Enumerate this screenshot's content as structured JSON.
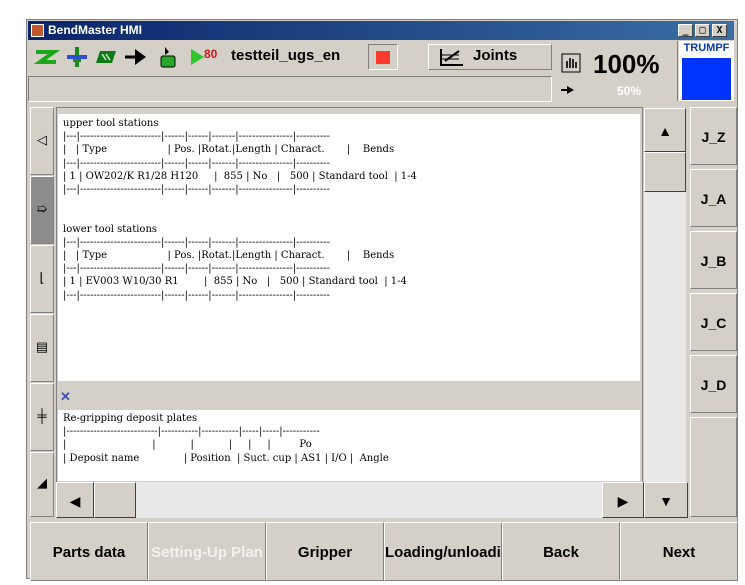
{
  "window": {
    "title": "BendMaster HMI",
    "controls": [
      "_",
      "□",
      "X"
    ]
  },
  "toolbar": {
    "program_name": "testteil_ugs_en",
    "io_label": "80",
    "joints_label": "Joints"
  },
  "feed": {
    "override": "100%",
    "secondary": "50%"
  },
  "brand": {
    "logo_text": "TRUMPF"
  },
  "upper_tools": {
    "lines": [
      "upper tool stations",
      "|---|------------------------|------|------|-------|----------------|----------",
      "|   | Type                   | Pos. |Rotat.|Length | Charact.       |    Bends",
      "|---|------------------------|------|------|-------|----------------|----------",
      "| 1 | OW202/K R1/28 H120     |  855 | No   |   500 | Standard tool  | 1-4",
      "|---|------------------------|------|------|-------|----------------|----------",
      "",
      "",
      "lower tool stations",
      "|---|------------------------|------|------|-------|----------------|----------",
      "|   | Type                   | Pos. |Rotat.|Length | Charact.       |    Bends",
      "|---|------------------------|------|------|-------|----------------|----------",
      "| 1 | EV003 W10/30 R1        |  855 | No   |   500 | Standard tool  | 1-4",
      "|---|------------------------|------|------|-------|----------------|----------"
    ]
  },
  "deposit": {
    "lines": [
      "Re-gripping deposit plates",
      "|---------------------------|-----------|-----------|-----|-----|-----------",
      "|                           |           |           |     |     |         Po",
      "| Deposit name              | Position  | Suct. cup | AS1 | I/O |  Angle"
    ]
  },
  "right_buttons": [
    "J_Z",
    "J_A",
    "J_B",
    "J_C",
    "J_D"
  ],
  "bottom_nav": [
    "Parts data",
    "Setting-Up Plan",
    "Gripper",
    "Loading/unloading",
    "Back",
    "Next"
  ]
}
